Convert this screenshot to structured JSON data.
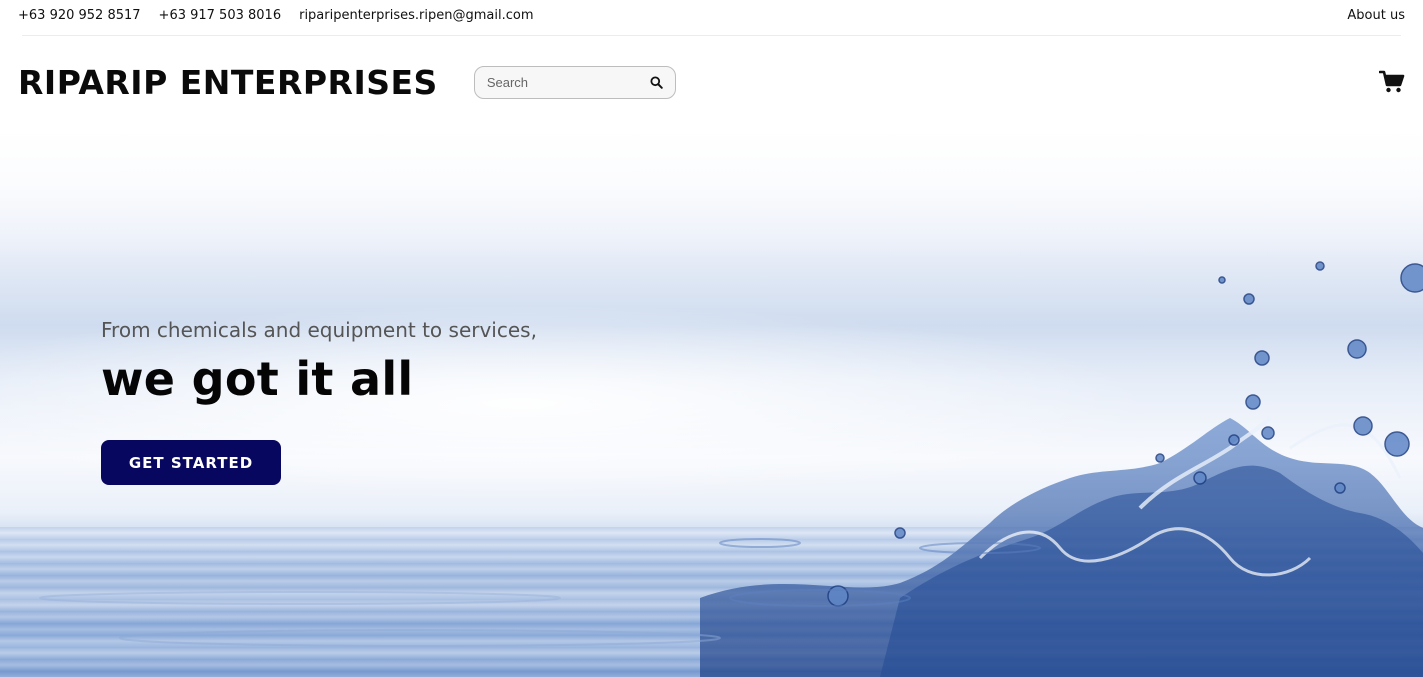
{
  "topbar": {
    "phone_1": "+63 920 952 8517",
    "phone_2": "+63 917 503 8016",
    "email": "riparipenterprises.ripen@gmail.com",
    "about_link": "About us"
  },
  "header": {
    "brand": "RIPARIP ENTERPRISES",
    "search": {
      "placeholder": "Search",
      "value": "",
      "icon": "search-icon"
    },
    "cart_icon": "cart-icon"
  },
  "hero": {
    "subtitle": "From chemicals and equipment to services,",
    "title": "we got it all",
    "cta_label": "GET STARTED"
  },
  "colors": {
    "cta_background": "#07075f",
    "text_dark": "#0a0a0a",
    "water_blue": "#2a4f9a"
  }
}
